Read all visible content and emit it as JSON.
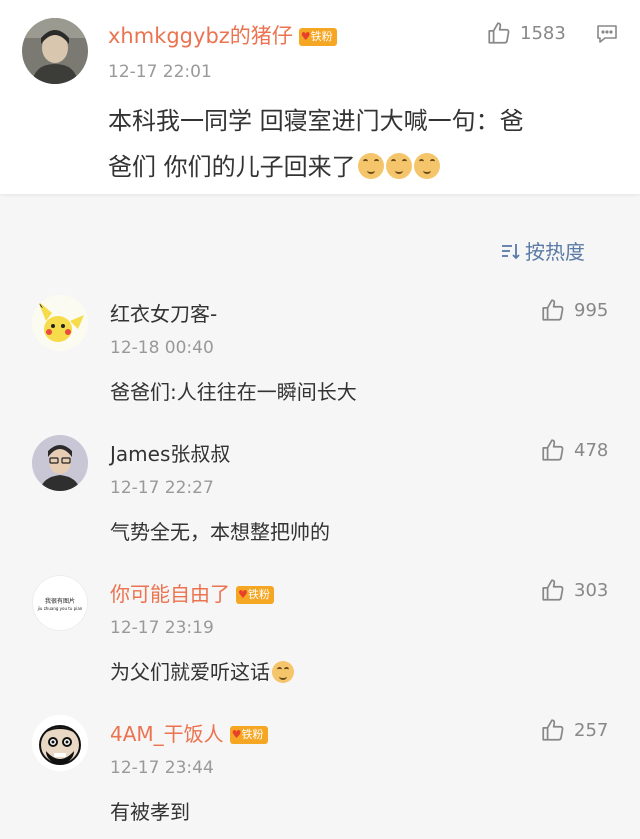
{
  "main_comment": {
    "username": "xhmkggybz的猪仔",
    "badge": "铁粉",
    "timestamp": "12-17 22:01",
    "text_line1": "本科我一同学 回寝室进门大喊一句：爸",
    "text_line2": "爸们 你们的儿子回来了",
    "likes": "1583",
    "emojis": [
      "doge-emoji",
      "doge-emoji",
      "doge-emoji"
    ]
  },
  "sort_label": "按热度",
  "replies": [
    {
      "username": "红衣女刀客-",
      "badge": "",
      "timestamp": "12-18 00:40",
      "text": "爸爸们:人往往在一瞬间长大",
      "likes": "995"
    },
    {
      "username": "James张叔叔",
      "badge": "",
      "timestamp": "12-17 22:27",
      "text": "气势全无，本想整把帅的",
      "likes": "478"
    },
    {
      "username": "你可能自由了",
      "badge": "铁粉",
      "timestamp": "12-17 23:19",
      "text": "为父们就爱听这话",
      "likes": "303",
      "avatar_text_top": "我很有图片",
      "avatar_text_bottom": "jiu zhuang you tu pian"
    },
    {
      "username": "4AM_干饭人",
      "badge": "铁粉",
      "timestamp": "12-17 23:44",
      "text": "有被孝到",
      "likes": "257"
    }
  ],
  "colors": {
    "username_orange": "#eb7350",
    "badge_gold": "#f5a623",
    "sort_blue": "#5b7aa6"
  }
}
